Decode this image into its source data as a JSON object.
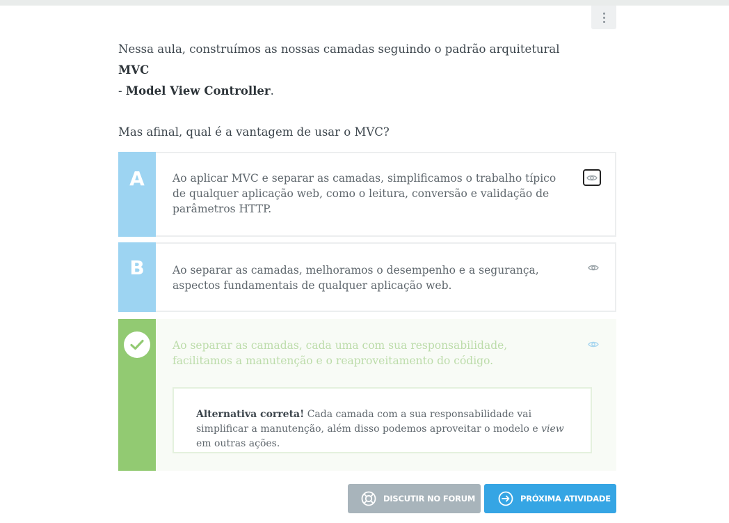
{
  "menu": {
    "icon": "kebab-menu-icon"
  },
  "question": {
    "intro_text": "Nessa aula, construímos as nossas camadas seguindo o padrão arquitetural ",
    "intro_bold1": "MVC",
    "intro_sep": "- ",
    "intro_bold2": "Model View Controller",
    "intro_end": ".",
    "question_text": "Mas afinal, qual é a vantagem de usar o MVC?"
  },
  "alternatives": [
    {
      "letter": "A",
      "text": "Ao aplicar MVC e separar as camadas, simplificamos o trabalho típico de qualquer aplicação web, como o leitura, conversão e validação de parâmetros HTTP.",
      "icon": "eye-icon"
    },
    {
      "letter": "B",
      "text": "Ao separar as camadas, melhoramos o desempenho e a segurança, aspectos fundamentais de qualquer aplicação web.",
      "icon": "eye-icon"
    },
    {
      "letter": "",
      "icon_marker": "check-icon",
      "text": "Ao separar as camadas, cada uma com sua responsabilidade, facilitamos a manutenção e o reaproveitamento do código.",
      "icon": "eye-icon",
      "feedback": {
        "bold": "Alternativa correta!",
        "text1": " Cada camada com a sua responsabilidade vai simplificar a manutenção, além disso podemos aproveitar o modelo e ",
        "italic": "view",
        "text2": " em outras ações."
      }
    }
  ],
  "buttons": {
    "forum": {
      "label": "DISCUTIR NO FORUM",
      "icon": "lifebuoy-icon"
    },
    "next": {
      "label": "PRÓXIMA ATIVIDADE",
      "icon": "arrow-right-circle-icon"
    }
  },
  "colors": {
    "letter_bg": "#9dd4f2",
    "correct_bg": "#92ca72",
    "forum_button": "#a8b4bb",
    "next_button": "#35a5e4"
  }
}
